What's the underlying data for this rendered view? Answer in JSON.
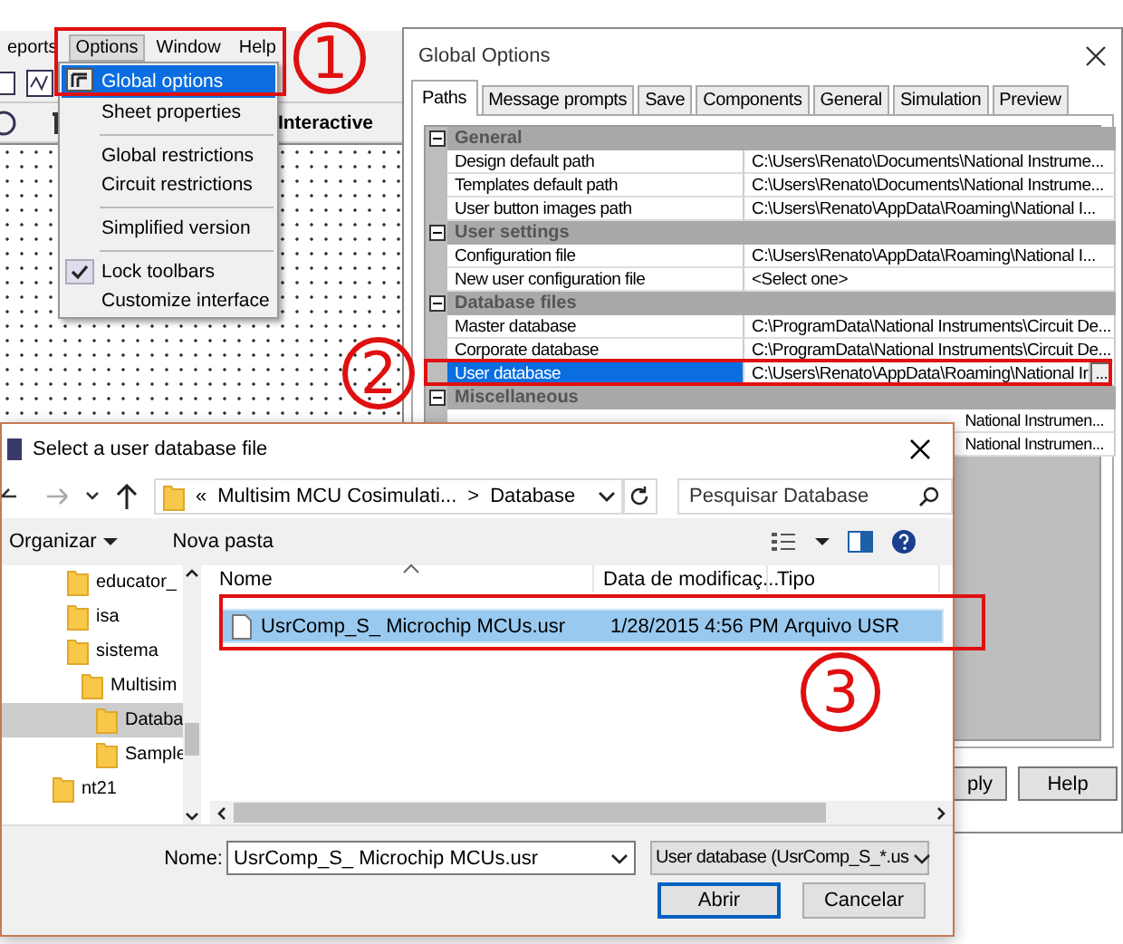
{
  "app": {
    "menu": [
      {
        "label": "eports",
        "selected": false
      },
      {
        "label": "Options",
        "selected": true
      },
      {
        "label": "Window",
        "selected": false
      },
      {
        "label": "Help",
        "selected": false
      }
    ],
    "toolbar_button": "Interactive",
    "options_menu": [
      {
        "kind": "item",
        "label": "Global options",
        "selected": true,
        "checked": false,
        "icon": true
      },
      {
        "kind": "item",
        "label": "Sheet properties",
        "selected": false,
        "checked": false
      },
      {
        "kind": "separator"
      },
      {
        "kind": "item",
        "label": "Global restrictions",
        "selected": false,
        "checked": false
      },
      {
        "kind": "item",
        "label": "Circuit restrictions",
        "selected": false,
        "checked": false
      },
      {
        "kind": "separator"
      },
      {
        "kind": "item",
        "label": "Simplified version",
        "selected": false,
        "checked": false
      },
      {
        "kind": "separator"
      },
      {
        "kind": "item",
        "label": "Lock toolbars",
        "selected": false,
        "checked": true
      },
      {
        "kind": "item",
        "label": "Customize interface",
        "selected": false,
        "checked": false
      }
    ]
  },
  "global_options": {
    "title": "Global Options",
    "tabs": [
      {
        "label": "Paths",
        "selected": true
      },
      {
        "label": "Message prompts",
        "selected": false
      },
      {
        "label": "Save",
        "selected": false
      },
      {
        "label": "Components",
        "selected": false
      },
      {
        "label": "General",
        "selected": false
      },
      {
        "label": "Simulation",
        "selected": false
      },
      {
        "label": "Preview",
        "selected": false
      }
    ],
    "groups": [
      {
        "name": "General",
        "expanded": true,
        "rows": [
          {
            "label": "Design default path",
            "value": "C:\\Users\\Renato\\Documents\\National Instrume...",
            "selected": false
          },
          {
            "label": "Templates default path",
            "value": "C:\\Users\\Renato\\Documents\\National Instrume...",
            "selected": false
          },
          {
            "label": "User button images path",
            "value": "C:\\Users\\Renato\\AppData\\Roaming\\National I...",
            "selected": false
          }
        ]
      },
      {
        "name": "User settings",
        "expanded": true,
        "rows": [
          {
            "label": "Configuration file",
            "value": "C:\\Users\\Renato\\AppData\\Roaming\\National I...",
            "selected": false
          },
          {
            "label": "New user configuration file",
            "value": "<Select one>",
            "selected": false
          }
        ]
      },
      {
        "name": "Database files",
        "expanded": true,
        "rows": [
          {
            "label": "Master database",
            "value": "C:\\ProgramData\\National Instruments\\Circuit De...",
            "selected": false
          },
          {
            "label": "Corporate database",
            "value": "C:\\ProgramData\\National Instruments\\Circuit De...",
            "selected": false
          },
          {
            "label": "User database",
            "value": "C:\\Users\\Renato\\AppData\\Roaming\\National Ir",
            "selected": true,
            "browse": "..."
          }
        ]
      },
      {
        "name": "Miscellaneous",
        "expanded": true,
        "rows": [
          {
            "kind": "partial",
            "value": "National Instrumen...",
            "selected": false
          },
          {
            "kind": "partial",
            "value": "National Instrumen...",
            "selected": false
          }
        ]
      }
    ],
    "buttons": [
      "ply",
      "Help"
    ]
  },
  "file_dialog": {
    "title": "Select a user database file",
    "path_overflow": "«",
    "path": [
      "Multisim MCU Cosimulati...",
      "Database"
    ],
    "path_separator": ">",
    "search": {
      "placeholder": "Pesquisar Database"
    },
    "toolbar": [
      "Organizar",
      "Nova pasta"
    ],
    "tree": {
      "nested": [
        {
          "label": "educator_",
          "selected": false
        },
        {
          "label": "isa",
          "selected": false
        },
        {
          "label": "sistema",
          "selected": false,
          "children": [
            {
              "label": "Multisim",
              "selected": false,
              "children": [
                {
                  "label": "Databa",
                  "selected": true
                },
                {
                  "label": "Sample",
                  "selected": false
                }
              ]
            }
          ]
        }
      ],
      "outer": [
        {
          "label": "nt21",
          "selected": false
        }
      ]
    },
    "columns": [
      "Nome",
      "Data de modificaç...",
      "Tipo"
    ],
    "files": [
      {
        "name": "UsrComp_S_ Microchip MCUs.usr",
        "date": "1/28/2015 4:56 PM",
        "type": "Arquivo USR",
        "selected": true
      }
    ],
    "name_label": "Nome:",
    "name_value": "UsrComp_S_ Microchip MCUs.usr",
    "filter": "User database (UsrComp_S_*.us",
    "buttons": [
      {
        "label": "Abrir",
        "default": true
      },
      {
        "label": "Cancelar",
        "default": false
      }
    ]
  },
  "annotations": [
    {
      "kind": "frame"
    },
    {
      "kind": "marker",
      "label": "1"
    },
    {
      "kind": "frame"
    },
    {
      "kind": "marker",
      "label": "2"
    },
    {
      "kind": "frame"
    },
    {
      "kind": "marker",
      "label": "3"
    }
  ]
}
